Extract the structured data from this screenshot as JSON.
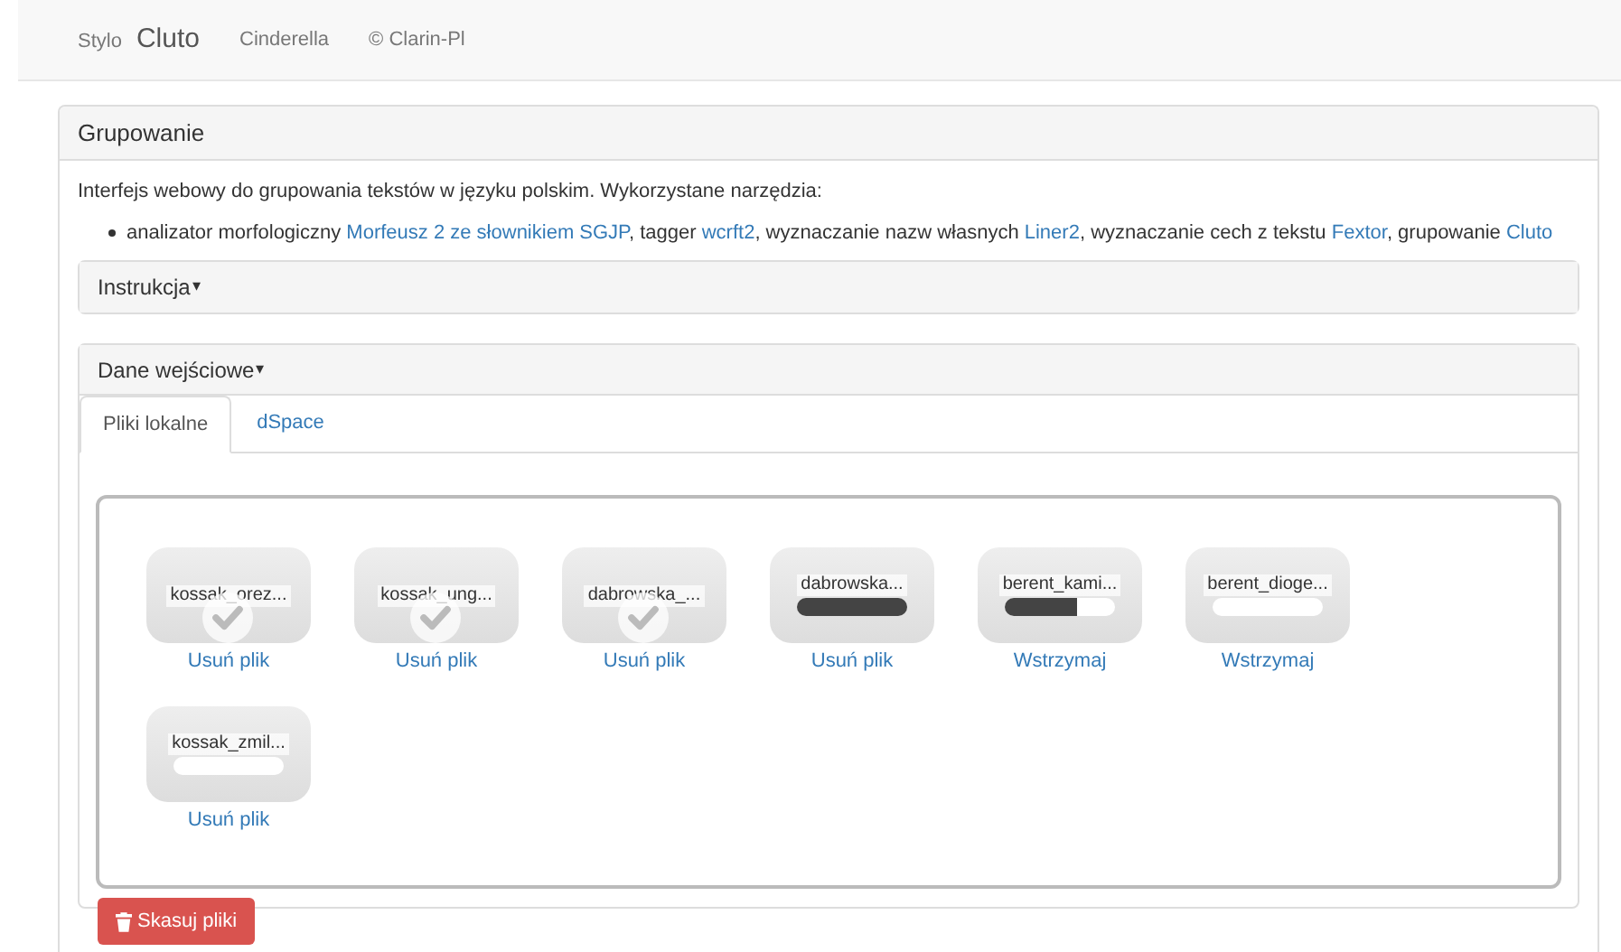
{
  "navbar": {
    "brand_small": "Stylo",
    "brand": "Cluto",
    "links": [
      "Cinderella",
      "© Clarin-Pl"
    ]
  },
  "panel": {
    "title": "Grupowanie",
    "intro": "Interfejs webowy do grupowania tekstów w języku polskim. Wykorzystane narzędzia:",
    "tools": [
      {
        "kind": "text",
        "text": "analizator morfologiczny "
      },
      {
        "kind": "link",
        "text": "Morfeusz 2 ze słownikiem SGJP"
      },
      {
        "kind": "text",
        "text": ", tagger "
      },
      {
        "kind": "link",
        "text": "wcrft2"
      },
      {
        "kind": "text",
        "text": ", wyznaczanie nazw własnych "
      },
      {
        "kind": "link",
        "text": "Liner2"
      },
      {
        "kind": "text",
        "text": ", wyznaczanie cech z tekstu "
      },
      {
        "kind": "link",
        "text": "Fextor"
      },
      {
        "kind": "text",
        "text": ", grupowanie "
      },
      {
        "kind": "link",
        "text": "Cluto"
      }
    ],
    "sections": [
      {
        "title": "Instrukcja",
        "caret": "▾"
      },
      {
        "title": "Dane wejściowe",
        "caret": "▾"
      }
    ],
    "tabs": [
      {
        "label": "Pliki lokalne",
        "selected": true
      },
      {
        "label": "dSpace",
        "selected": false
      }
    ],
    "files": [
      {
        "name": "kossak_orez...",
        "kind": "done",
        "action": "Usuń plik"
      },
      {
        "name": "kossak_ung...",
        "kind": "done",
        "action": "Usuń plik"
      },
      {
        "name": "dabrowska_...",
        "kind": "done",
        "action": "Usuń plik"
      },
      {
        "name": "dabrowska...",
        "kind": "progress",
        "level": 1,
        "action": "Usuń plik"
      },
      {
        "name": "berent_kami...",
        "kind": "progress",
        "level": 0.65,
        "action": "Wstrzymaj"
      },
      {
        "name": "berent_dioge...",
        "kind": "progress",
        "level": 0,
        "action": "Wstrzymaj"
      },
      {
        "name": "kossak_zmil...",
        "kind": "progress",
        "level": 0,
        "action": "Usuń plik"
      }
    ],
    "delete_button": "Skasuj pliki"
  }
}
